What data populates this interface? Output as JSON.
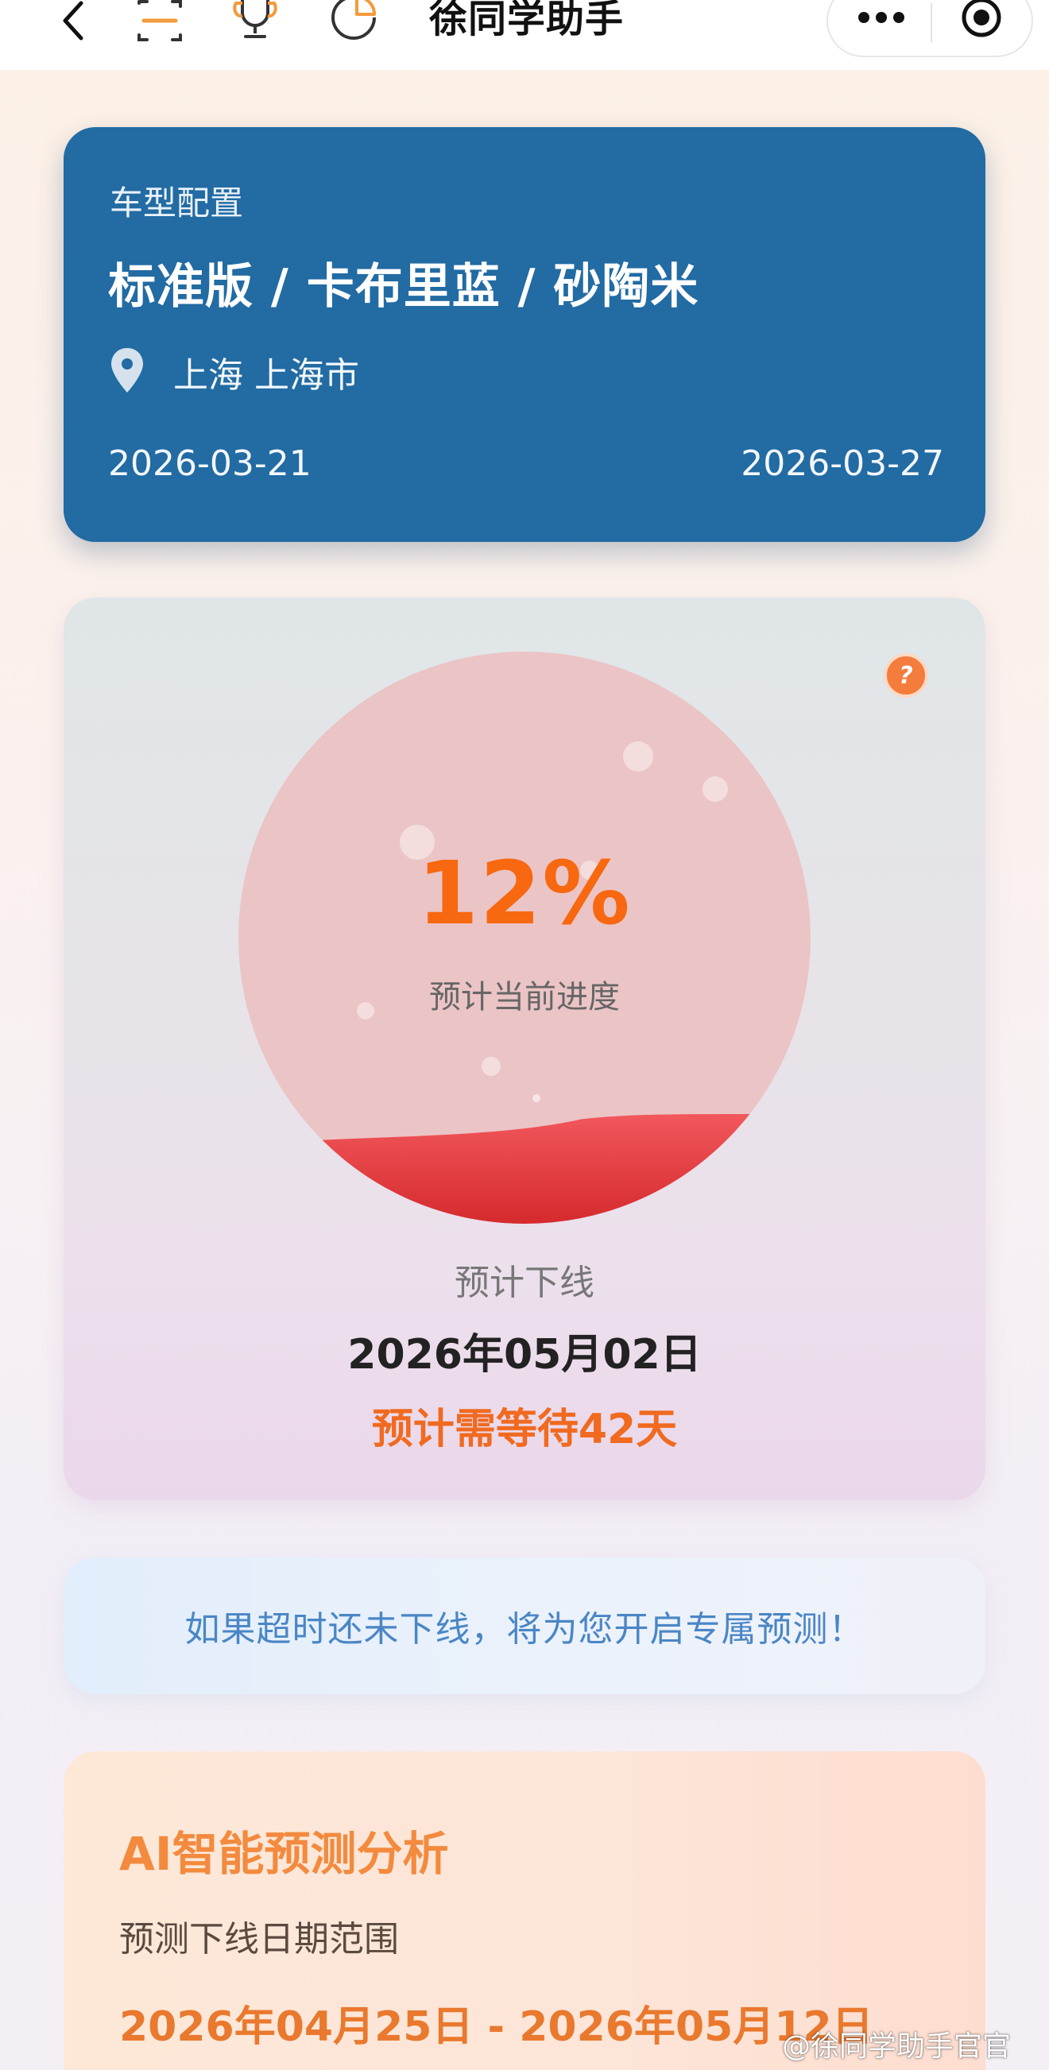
{
  "nav": {
    "title": "徐同学助手",
    "icons": [
      "back-icon",
      "scan-icon",
      "trophy-icon",
      "pie-chart-icon",
      "more-icon",
      "target-icon"
    ]
  },
  "config": {
    "label": "车型配置",
    "model": "标准版 / 卡布里蓝 / 砂陶米",
    "location": "上海 上海市",
    "date_start": "2026-03-21",
    "date_end": "2026-03-27"
  },
  "progress": {
    "percent_text": "12%",
    "percent_value": 0.12,
    "label": "预计当前进度",
    "offline_label": "预计下线",
    "offline_date": "2026年05月02日",
    "wait_text": "预计需等待42天",
    "help_glyph": "?"
  },
  "notice": {
    "text": "如果超时还未下线，将为您开启专属预测！"
  },
  "ai": {
    "title": "AI智能预测分析",
    "subtitle": "预测下线日期范围",
    "range": "2026年04月25日 - 2026年05月12日"
  },
  "watermark": "@徐同学助手官官",
  "colors": {
    "config_card": "#226ba3",
    "accent_orange": "#f76810",
    "notice_blue": "#4a86c6",
    "wave_red": "#e2373a"
  }
}
